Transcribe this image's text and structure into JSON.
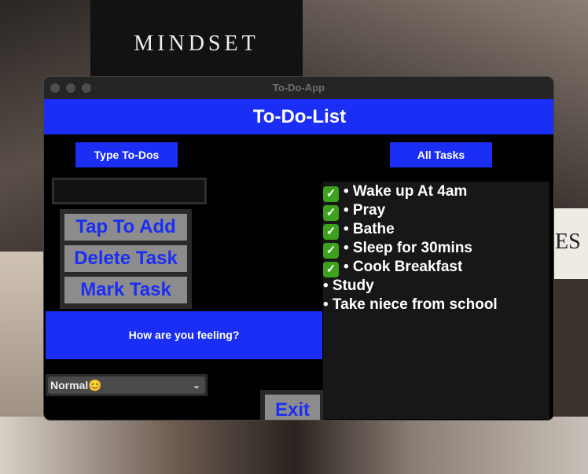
{
  "background": {
    "mindset_text": "MINDSET",
    "right_fragment": "ES"
  },
  "window": {
    "title": "To-Do-App"
  },
  "header": {
    "title": "To-Do-List"
  },
  "left": {
    "type_label": "Type To-Dos",
    "entry_value": "",
    "buttons": {
      "add": "Tap To Add",
      "delete": "Delete Task",
      "mark": "Mark Task"
    },
    "feeling_label": "How are you feeling?",
    "mood_selected": "Normal😊",
    "exit": "Exit"
  },
  "right": {
    "tasks_label": "All Tasks",
    "tasks": [
      {
        "text": "• Wake up At 4am",
        "done": true
      },
      {
        "text": "• Pray",
        "done": true
      },
      {
        "text": "• Bathe",
        "done": true
      },
      {
        "text": "• Sleep for 30mins",
        "done": true
      },
      {
        "text": "• Cook Breakfast",
        "done": true
      },
      {
        "text": "• Study",
        "done": false
      },
      {
        "text": "• Take niece from school",
        "done": false
      }
    ]
  },
  "colors": {
    "accent": "#1a2ef5",
    "button_bg": "#8c8c8c",
    "check": "#3ca21d"
  }
}
